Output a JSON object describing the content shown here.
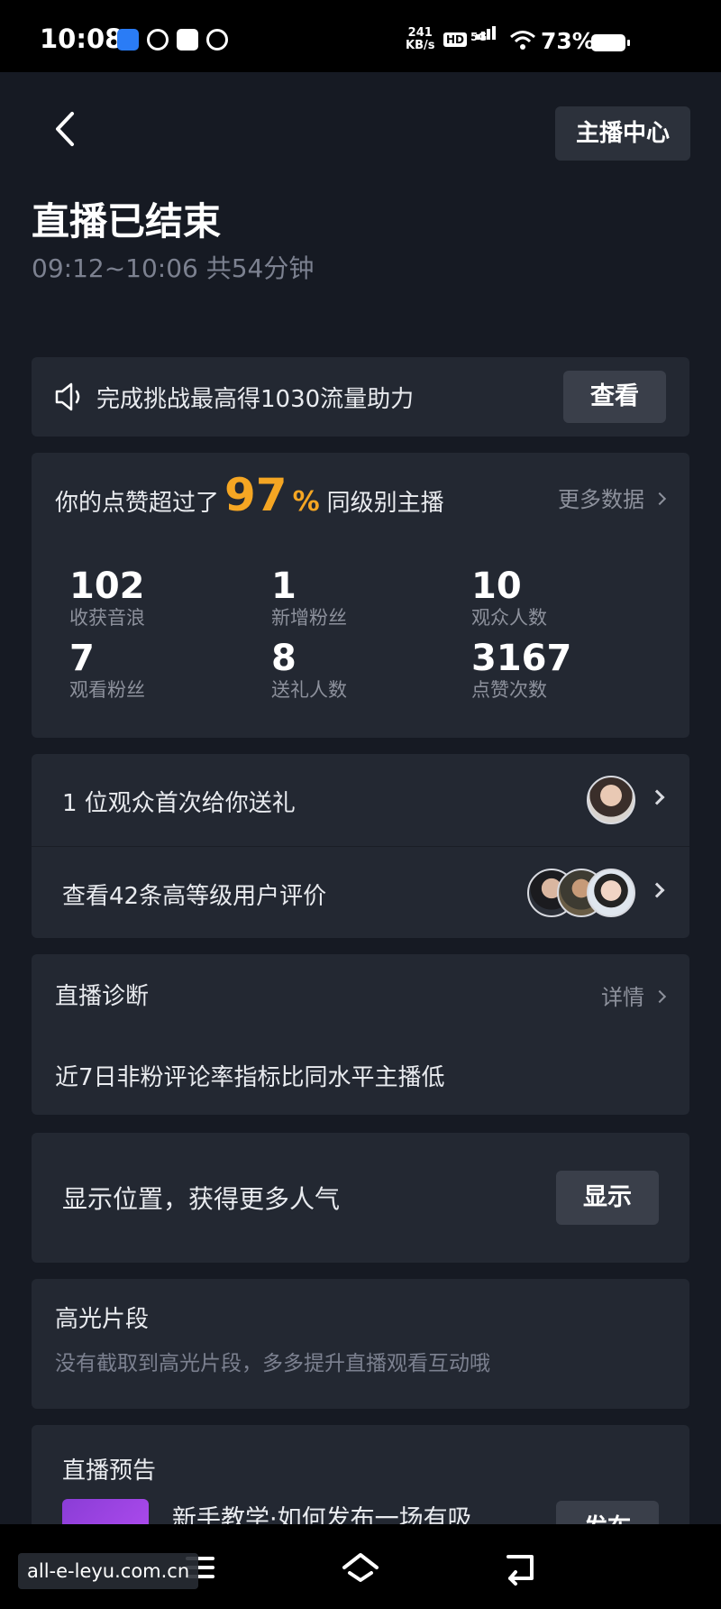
{
  "status_bar": {
    "time": "10:08",
    "net_speed_value": "241",
    "net_speed_unit": "KB/s",
    "hd": "HD",
    "network": "5G",
    "battery": "73%"
  },
  "header": {
    "anchor_center_label": "主播中心",
    "title": "直播已结束",
    "subtitle": "09:12~10:06 共54分钟"
  },
  "challenge": {
    "text": "完成挑战最高得1030流量助力",
    "button": "查看"
  },
  "stats": {
    "headline_prefix": "你的点赞超过了",
    "percent": "97",
    "percent_sign": "%",
    "headline_suffix": "同级别主播",
    "more_label": "更多数据",
    "items": [
      {
        "value": "102",
        "label": "收获音浪"
      },
      {
        "value": "1",
        "label": "新增粉丝"
      },
      {
        "value": "10",
        "label": "观众人数"
      },
      {
        "value": "7",
        "label": "观看粉丝"
      },
      {
        "value": "8",
        "label": "送礼人数"
      },
      {
        "value": "3167",
        "label": "点赞次数"
      }
    ]
  },
  "rows": [
    {
      "text": "1 位观众首次给你送礼"
    },
    {
      "text": "查看42条高等级用户评价"
    }
  ],
  "diagnosis": {
    "title": "直播诊断",
    "more_label": "详情",
    "body": "近7日非粉评论率指标比同水平主播低"
  },
  "location": {
    "text": "显示位置，获得更多人气",
    "button": "显示"
  },
  "highlight": {
    "title": "高光片段",
    "subtitle": "没有截取到高光片段，多多提升直播观看互动哦"
  },
  "preview": {
    "title": "直播预告",
    "item_title": "新手教学·如何发布一场有吸",
    "button": "发布"
  },
  "watermark": "all-e-leyu.com.cn"
}
